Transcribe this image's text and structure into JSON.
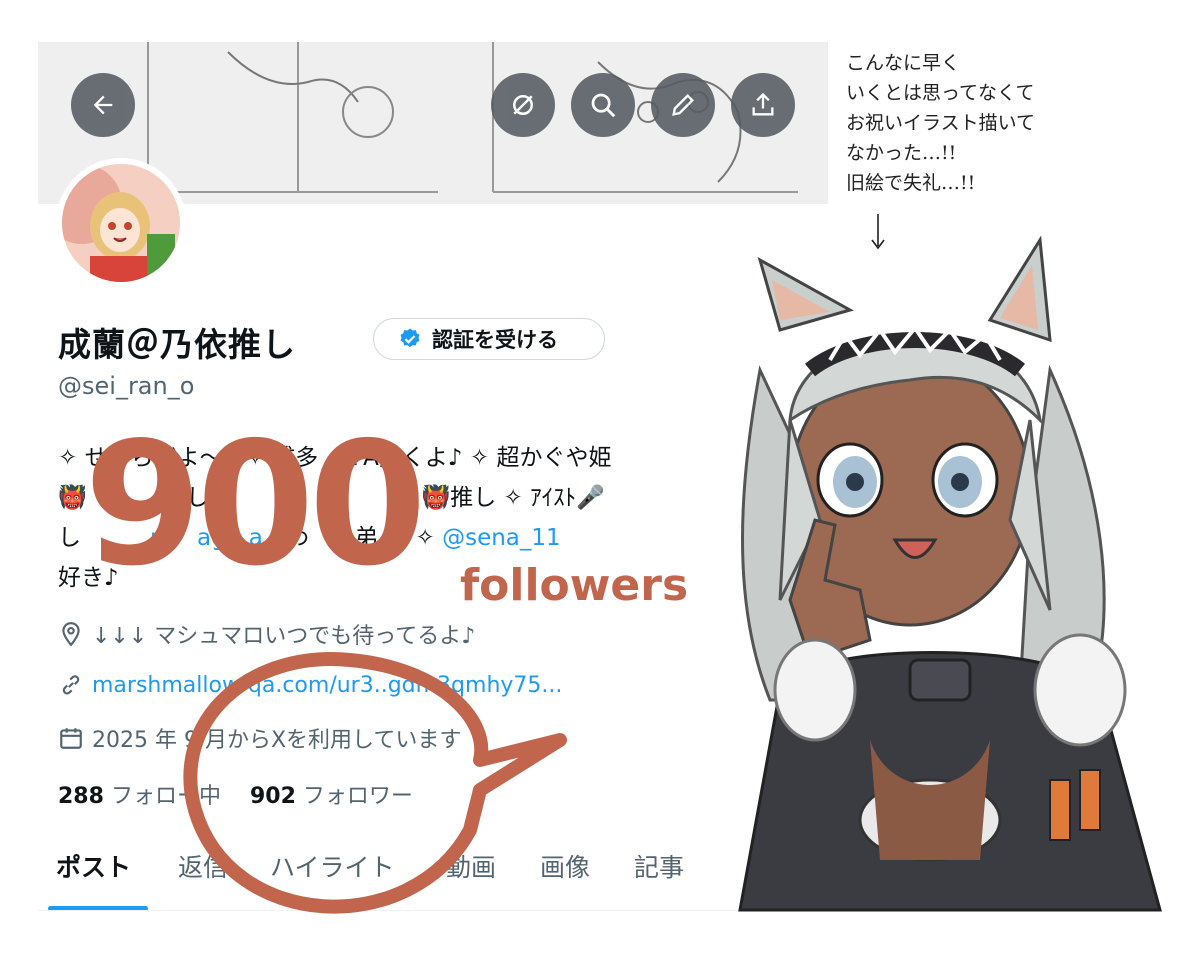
{
  "header": {
    "back_icon": "arrow-left-icon",
    "action_icons": [
      "broken-link-icon",
      "search-icon",
      "pencil-icon",
      "share-icon"
    ]
  },
  "profile": {
    "display_name": "成蘭＠乃依推し",
    "verify_button_label": "認証を受ける",
    "handle": "@sei_ran_o",
    "bio_line1": "✧ せいらだよ〜！✧ 雑多 ✧ FA描くよ♪ ✧ 超かぐや姫",
    "bio_line2": "👹 　　　推し　　　ほ　　　　🗻👹推し ✧ ｱｲｽﾄ🎤",
    "bio_line3_prefix": "し　　　",
    "bio_line3_link1": "ru　ag　a",
    "bio_line3_mid": "　わ　ぃ弟♪）✧ ",
    "bio_line3_link2": "@sena_11",
    "bio_line4": "好き♪",
    "location": "↓↓↓ マシュマロいつでも待ってるよ♪",
    "website": "marshmallow-qa.com/ur3..gdm3qmhy75...",
    "joined": "2025 年 9 月からXを利用しています",
    "following_count": "288",
    "following_label": "フォロー中",
    "followers_count": "902",
    "followers_label": "フォロワー"
  },
  "tabs": [
    "ポスト",
    "返信",
    "ハイライト",
    "動画",
    "画像",
    "記事"
  ],
  "overlay": {
    "big_number": "900",
    "big_word": "followers",
    "handwritten_note": "こんなに早く\nいくとは思ってなくて\nお祝いイラスト描いて\nなかった…!!\n旧絵で失礼…!!"
  },
  "colors": {
    "accent": "#1d9bf0",
    "overlay_brown": "#c1664c",
    "text_primary": "#0f1419",
    "text_secondary": "#536471"
  }
}
